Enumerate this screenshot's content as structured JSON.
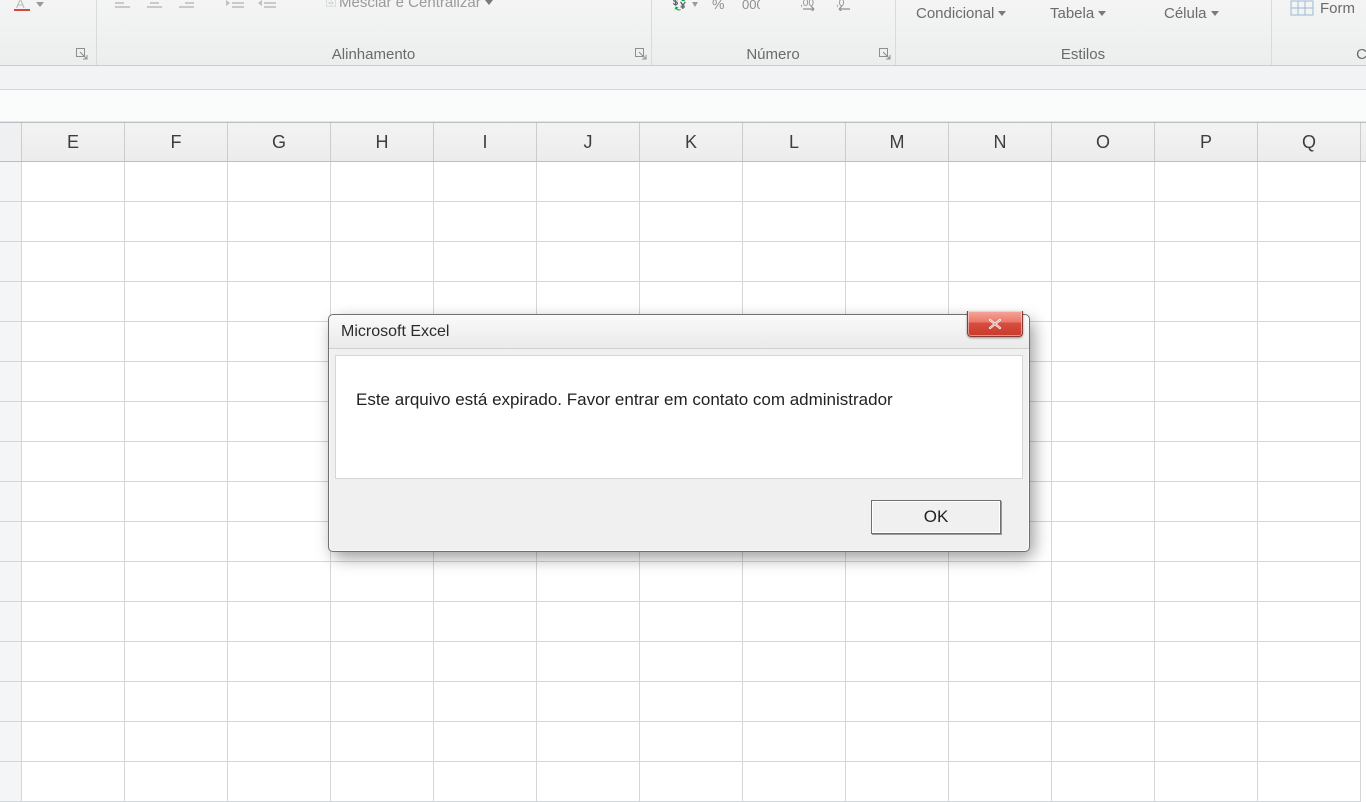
{
  "ribbon": {
    "groups": {
      "font_launcher": true,
      "alignment": {
        "label": "Alinhamento",
        "merge_label": "Mesclar e Centralizar"
      },
      "number": {
        "label": "Número"
      },
      "styles": {
        "label": "Estilos",
        "conditional": "Condicional",
        "table": "Tabela",
        "cell": "Célula"
      },
      "cells": {
        "label": "Célu",
        "format": "Form"
      }
    }
  },
  "columns": [
    "E",
    "F",
    "G",
    "H",
    "I",
    "J",
    "K",
    "L",
    "M",
    "N",
    "O",
    "P",
    "Q"
  ],
  "rows_visible": 16,
  "dialog": {
    "title": "Microsoft Excel",
    "message": "Este arquivo está expirado. Favor entrar em contato com administrador",
    "ok_label": "OK"
  }
}
